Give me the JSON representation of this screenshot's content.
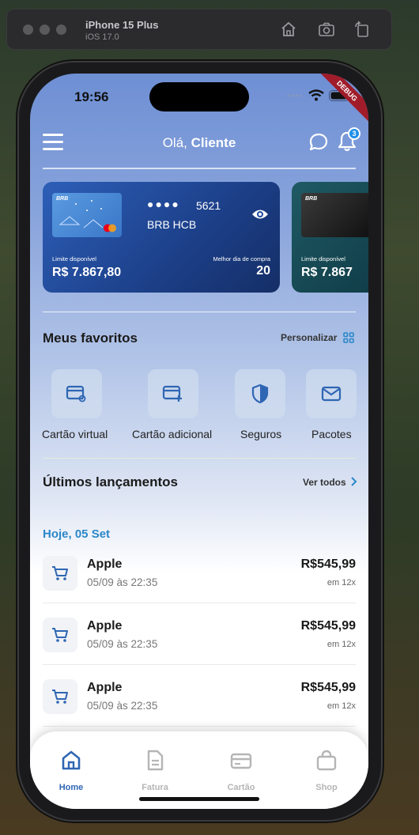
{
  "simulator": {
    "device": "iPhone 15 Plus",
    "os": "iOS 17.0"
  },
  "status_bar": {
    "time": "19:56",
    "debug_label": "DEBUG"
  },
  "header": {
    "greeting_prefix": "Olá,",
    "greeting_name": "Cliente",
    "notification_count": "3"
  },
  "cards": [
    {
      "thumb_logo": "BRB",
      "dots": "●●●●",
      "last4": "5621",
      "name": "BRB HCB",
      "limit_label": "Limite disponível",
      "limit_value": "R$ 7.867,80",
      "best_day_label": "Melhor dia de compra",
      "best_day_value": "20",
      "color": "#1f4a9c"
    },
    {
      "thumb_logo": "BRB",
      "limit_label": "Limite disponível",
      "limit_value": "R$ 7.867",
      "color": "#0f4a52"
    }
  ],
  "favorites": {
    "title": "Meus favoritos",
    "customize_label": "Personalizar",
    "items": [
      {
        "label": "Cartão virtual",
        "icon": "virtual-card-icon"
      },
      {
        "label": "Cartão adicional",
        "icon": "additional-card-icon"
      },
      {
        "label": "Seguros",
        "icon": "shield-icon"
      },
      {
        "label": "Pacotes",
        "icon": "envelope-icon"
      }
    ]
  },
  "launches": {
    "title": "Últimos lançamentos",
    "see_all_label": "Ver todos",
    "date_group": "Hoje, 05 Set",
    "items": [
      {
        "name": "Apple",
        "datetime": "05/09 às 22:35",
        "amount": "R$545,99",
        "installments": "em 12x"
      },
      {
        "name": "Apple",
        "datetime": "05/09 às 22:35",
        "amount": "R$545,99",
        "installments": "em 12x"
      },
      {
        "name": "Apple",
        "datetime": "05/09 às 22:35",
        "amount": "R$545,99",
        "installments": "em 12x"
      }
    ]
  },
  "bottom_nav": {
    "items": [
      {
        "label": "Home",
        "icon": "home-icon",
        "active": true
      },
      {
        "label": "Fatura",
        "icon": "invoice-icon",
        "active": false
      },
      {
        "label": "Cartão",
        "icon": "card-icon",
        "active": false
      },
      {
        "label": "Shop",
        "icon": "shopping-bag-icon",
        "active": false
      }
    ]
  },
  "colors": {
    "accent": "#2f66b3",
    "date_blue": "#2a87c9",
    "inactive": "#b5b5b5"
  }
}
